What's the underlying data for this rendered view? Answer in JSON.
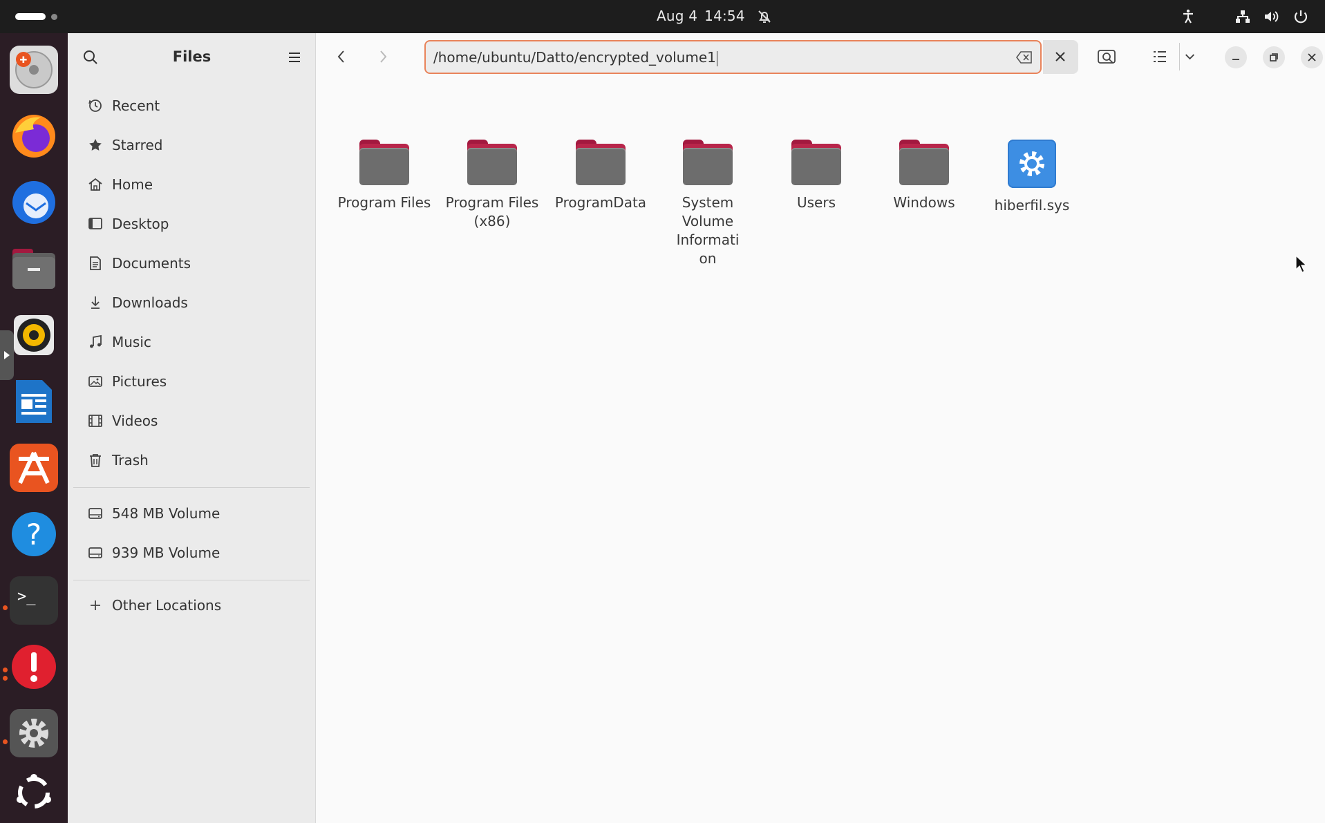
{
  "topbar": {
    "date": "Aug 4",
    "time": "14:54"
  },
  "dock": {
    "apps": [
      "disk-usage-analyzer",
      "firefox",
      "thunderbird",
      "files",
      "rhythmbox",
      "libreoffice-writer",
      "app-center",
      "help",
      "terminal",
      "software-updater",
      "settings",
      "ubuntu-logo"
    ]
  },
  "sidebar": {
    "title": "Files",
    "places": [
      {
        "label": "Recent",
        "icon": "clock-icon"
      },
      {
        "label": "Starred",
        "icon": "star-icon"
      },
      {
        "label": "Home",
        "icon": "home-icon"
      },
      {
        "label": "Desktop",
        "icon": "desktop-icon"
      },
      {
        "label": "Documents",
        "icon": "document-icon"
      },
      {
        "label": "Downloads",
        "icon": "download-icon"
      },
      {
        "label": "Music",
        "icon": "music-icon"
      },
      {
        "label": "Pictures",
        "icon": "picture-icon"
      },
      {
        "label": "Videos",
        "icon": "video-icon"
      },
      {
        "label": "Trash",
        "icon": "trash-icon"
      }
    ],
    "volumes": [
      {
        "label": "548 MB Volume",
        "icon": "drive-icon"
      },
      {
        "label": "939 MB Volume",
        "icon": "drive-icon"
      }
    ],
    "other_locations": "Other Locations"
  },
  "header": {
    "location": "/home/ubuntu/Datto/encrypted_volume1"
  },
  "files": [
    {
      "name": "Program Files",
      "type": "folder"
    },
    {
      "name": "Program Files (x86)",
      "type": "folder"
    },
    {
      "name": "ProgramData",
      "type": "folder"
    },
    {
      "name": "System Volume Information",
      "type": "folder"
    },
    {
      "name": "Users",
      "type": "folder"
    },
    {
      "name": "Windows",
      "type": "folder"
    },
    {
      "name": "hiberfil.sys",
      "type": "system-file"
    }
  ],
  "colors": {
    "accent": "#e95420",
    "folder_tab": "#b8254a",
    "folder_body": "#6d6d6d",
    "dock_bg": "#2b1d25",
    "topbar_bg": "#1d1d1d"
  }
}
